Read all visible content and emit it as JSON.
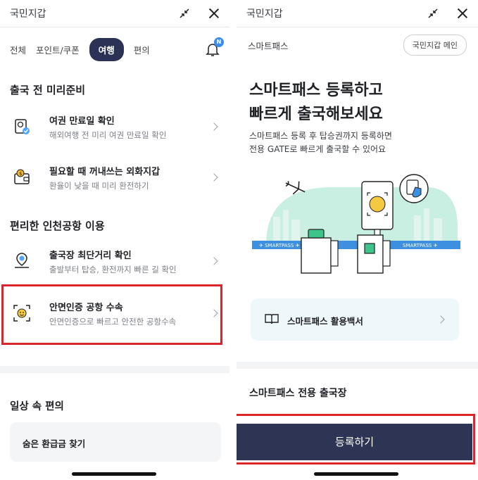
{
  "left": {
    "app_title": "국민지갑",
    "tabs": [
      "전체",
      "포인트/쿠폰",
      "여행",
      "편의"
    ],
    "notification_badge": "N",
    "section1_title": "출국 전 미리준비",
    "items1": [
      {
        "title": "여권 만료일 확인",
        "desc": "해외여행 전 미리 여권 만료일 확인"
      },
      {
        "title": "필요할 때 꺼내쓰는 외화지갑",
        "desc": "환율이 낮을 때 미리 환전하기"
      }
    ],
    "section2_title": "편리한 인천공항 이용",
    "items2": [
      {
        "title": "출국장 최단거리 확인",
        "desc": "출발부터 탑승, 환전까지 빠른 길 확인"
      },
      {
        "title": "안면인증 공항 수속",
        "desc": "안면인증으로 빠르고 안전한 공항수속"
      }
    ],
    "section3_title": "일상 속 편의",
    "refund_card": "숨은 환급금 찾기"
  },
  "right": {
    "app_title": "국민지갑",
    "subheader": "스마트패스",
    "main_button": "국민지갑 메인",
    "hero_title": "스마트패스 등록하고\n빠르게 출국해보세요",
    "hero_desc": "스마트패스 등록 후 탑승권까지 등록하면\n전용 GATE로 빠르게 출국할 수 있어요",
    "smartpass_sign_left": "✈ SMARTPASS ✈",
    "smartpass_sign_right": "SMARTPASS ✈",
    "guide_card": "스마트패스 활용백서",
    "exit_title": "스마트패스 전용 출국장",
    "register_button": "등록하기"
  },
  "colors": {
    "accent_navy": "#2b3256",
    "highlight_red": "#d9262c",
    "badge_blue": "#3b8df0",
    "illustration_mint": "#c9efe3"
  }
}
